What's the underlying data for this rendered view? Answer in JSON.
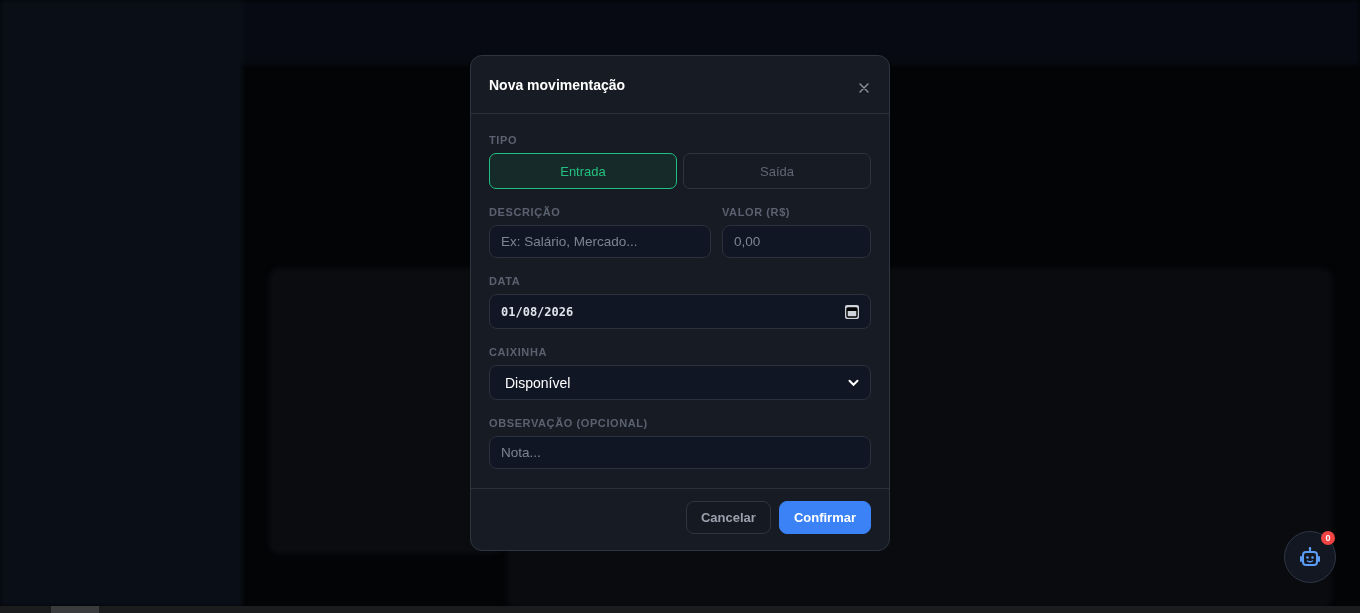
{
  "dialog": {
    "title": "Nova movimentação",
    "type_group": {
      "label": "TIPO",
      "options": [
        {
          "label": "Entrada",
          "selected": true
        },
        {
          "label": "Saída",
          "selected": false
        }
      ]
    },
    "fields": [
      {
        "kind": "text",
        "label": "DESCRIÇÃO",
        "placeholder": "Ex: Salário, Mercado..."
      },
      {
        "kind": "text",
        "label": "VALOR (R$)",
        "placeholder": "0,00"
      },
      {
        "kind": "date",
        "label": "DATA",
        "value": "01/08/2026"
      },
      {
        "kind": "select",
        "label": "CAIXINHA",
        "value": "Disponível"
      },
      {
        "kind": "text",
        "label": "OBSERVAÇÃO (OPCIONAL)",
        "placeholder": "Nota..."
      }
    ],
    "buttons": [
      {
        "label": "Cancelar",
        "kind": "secondary"
      },
      {
        "label": "Confirmar",
        "kind": "primary"
      }
    ]
  },
  "assistant_button": {
    "badge": "0"
  }
}
